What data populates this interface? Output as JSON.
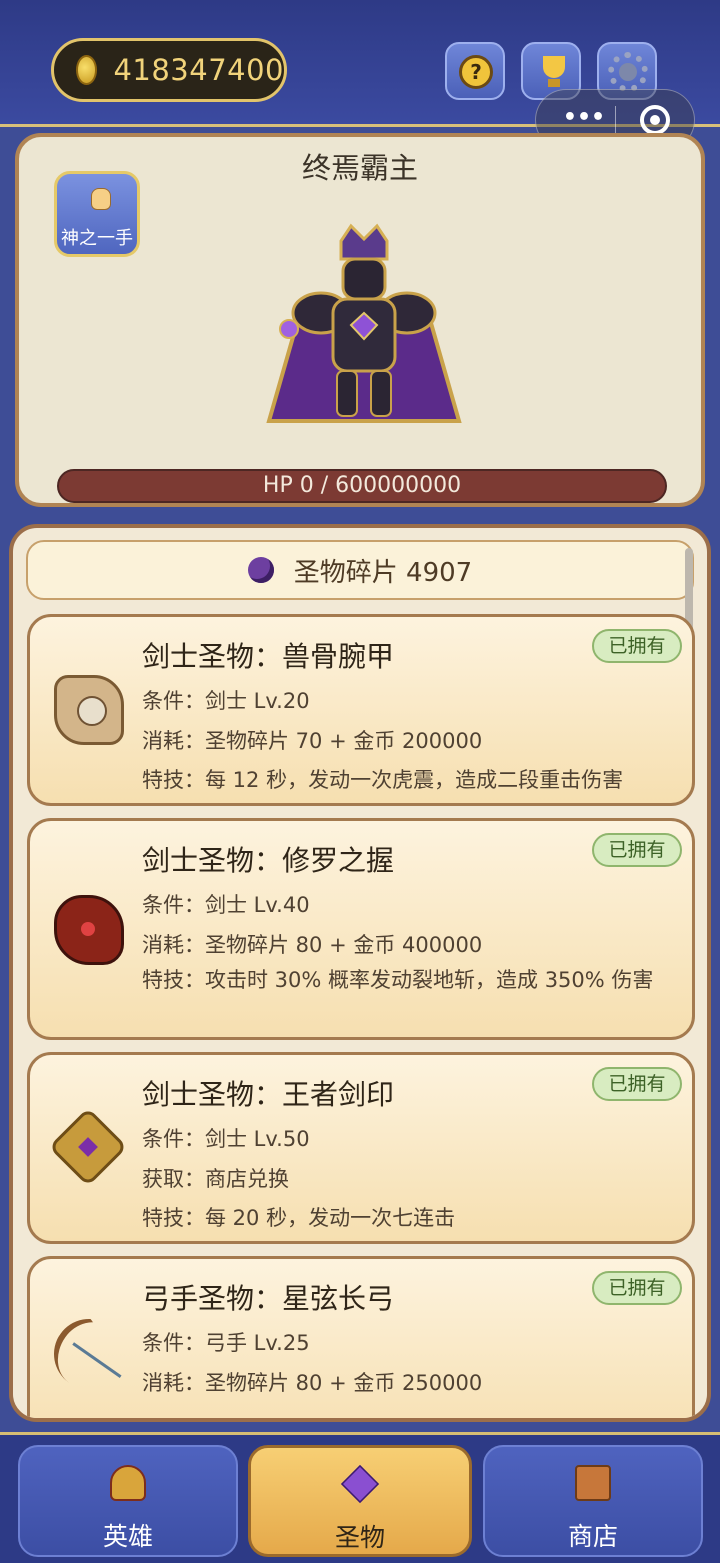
{
  "header": {
    "coins": "418347400",
    "help_icon": "question-icon",
    "ranking_icon": "trophy-icon",
    "settings_icon": "gear-icon",
    "capsule_more": "•••"
  },
  "boss": {
    "name": "终焉霸主",
    "skill_button_label": "神之一手",
    "hp_text": "HP 0 / 600000000",
    "hp_fraction": 0
  },
  "relics": {
    "shard_label": "圣物碎片 4907",
    "cards": [
      {
        "title": "剑士圣物：兽骨腕甲",
        "badge": "已拥有",
        "condition": "条件：剑士 Lv.20",
        "cost": "消耗：圣物碎片 70 + 金币 200000",
        "skill": "特技：每 12 秒，发动一次虎震，造成二段重击伤害",
        "icon": "bone-bracer-icon"
      },
      {
        "title": "剑士圣物：修罗之握",
        "badge": "已拥有",
        "condition": "条件：剑士 Lv.40",
        "cost": "消耗：圣物碎片 80 + 金币 400000",
        "skill": "特技：攻击时 30% 概率发动裂地斩，造成 350% 伤害",
        "icon": "demon-claw-icon"
      },
      {
        "title": "剑士圣物：王者剑印",
        "badge": "已拥有",
        "condition": "条件：剑士 Lv.50",
        "cost": "获取：商店兑换",
        "skill": "特技：每 20 秒，发动一次七连击",
        "icon": "king-seal-icon"
      },
      {
        "title": "弓手圣物：星弦长弓",
        "badge": "已拥有",
        "condition": "条件：弓手 Lv.25",
        "cost": "消耗：圣物碎片 80 + 金币 250000",
        "icon": "star-bow-icon"
      }
    ]
  },
  "nav": {
    "tabs": [
      {
        "label": "英雄",
        "icon": "helmet-icon"
      },
      {
        "label": "圣物",
        "icon": "crystal-icon"
      },
      {
        "label": "商店",
        "icon": "shop-icon"
      }
    ],
    "active": "圣物"
  }
}
